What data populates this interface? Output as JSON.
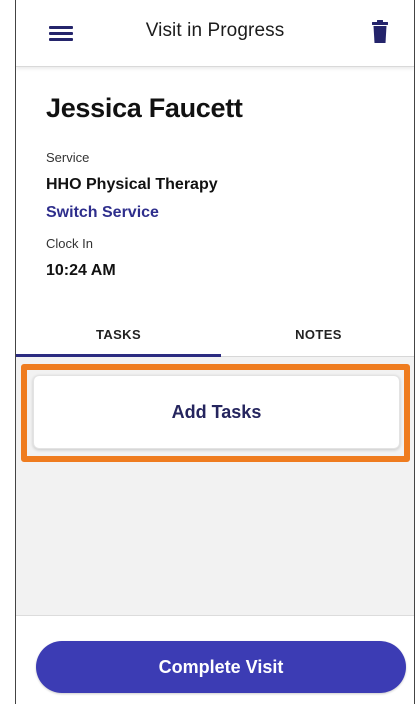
{
  "header": {
    "title": "Visit in Progress",
    "menu_icon": "hamburger-menu-icon",
    "delete_icon": "trash-icon",
    "accent_color": "#24246b"
  },
  "patient": {
    "name": "Jessica Faucett"
  },
  "service": {
    "label": "Service",
    "value": "HHO Physical Therapy",
    "switch_link": "Switch Service"
  },
  "clock_in": {
    "label": "Clock In",
    "value": "10:24 AM"
  },
  "tabs": [
    {
      "label": "TASKS",
      "selected": true
    },
    {
      "label": "NOTES",
      "selected": false
    }
  ],
  "tasks": {
    "add_button": "Add Tasks",
    "highlight_color": "#ef7c1f"
  },
  "footer": {
    "complete_button": "Complete Visit",
    "button_color": "#3c3cb4"
  }
}
